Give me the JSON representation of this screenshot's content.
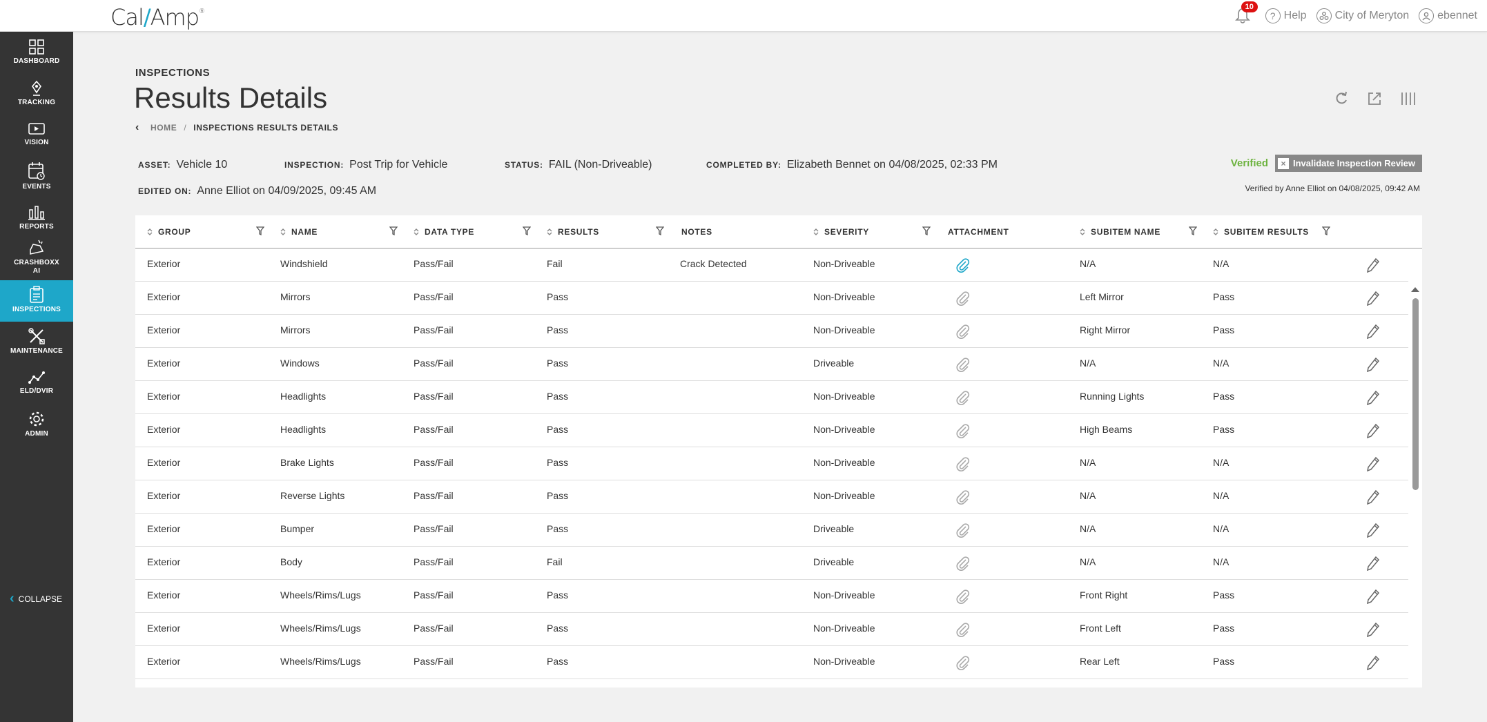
{
  "app": {
    "logo": {
      "left": "Cal",
      "slash": "/",
      "right": "Amp",
      "mark": "®"
    },
    "notifications_count": "10",
    "help_label": "Help",
    "org_label": "City of Meryton",
    "user_label": "ebennet"
  },
  "sidebar": {
    "items": [
      {
        "label": "DASHBOARD",
        "icon": "dashboard-icon"
      },
      {
        "label": "TRACKING",
        "icon": "location-pin-icon"
      },
      {
        "label": "VISION",
        "icon": "video-camera-icon"
      },
      {
        "label": "EVENTS",
        "icon": "calendar-clock-icon"
      },
      {
        "label": "REPORTS",
        "icon": "bar-chart-icon"
      },
      {
        "label": "CRASHBOXX AI",
        "icon": "crash-car-icon"
      },
      {
        "label": "INSPECTIONS",
        "icon": "clipboard-icon"
      },
      {
        "label": "MAINTENANCE",
        "icon": "wrench-screwdriver-icon"
      },
      {
        "label": "ELD/DVIR",
        "icon": "route-icon"
      },
      {
        "label": "ADMIN",
        "icon": "gear-icon"
      }
    ],
    "collapse_label": "COLLAPSE"
  },
  "page": {
    "section": "INSPECTIONS",
    "title": "Results Details",
    "breadcrumb_home": "HOME",
    "breadcrumb_sep": "/",
    "breadcrumb_current": "INSPECTIONS RESULTS DETAILS"
  },
  "meta": {
    "asset_label": "ASSET:",
    "asset": "Vehicle 10",
    "inspection_label": "INSPECTION:",
    "inspection": "Post Trip for Vehicle",
    "status_label": "STATUS:",
    "status": "FAIL (Non-Driveable)",
    "completed_label": "COMPLETED BY:",
    "completed": "Elizabeth Bennet on 04/08/2025, 02:33 PM",
    "edited_label": "EDITED ON:",
    "edited": "Anne Elliot on 04/09/2025, 09:45 AM",
    "verified_label": "Verified",
    "invalidate_label": "Invalidate Inspection Review",
    "verified_by": "Verified by Anne Elliot on 04/08/2025, 09:42 AM"
  },
  "colors": {
    "accent": "#1ea7c9",
    "verified": "#6db33f",
    "sidebar": "#343434"
  },
  "table": {
    "headers": [
      "GROUP",
      "NAME",
      "DATA TYPE",
      "RESULTS",
      "NOTES",
      "SEVERITY",
      "ATTACHMENT",
      "SUBITEM NAME",
      "SUBITEM RESULTS"
    ],
    "rows": [
      {
        "group": "Exterior",
        "name": "Windshield",
        "type": "Pass/Fail",
        "result": "Fail",
        "notes": "Crack Detected",
        "severity": "Non-Driveable",
        "attachment": true,
        "subname": "N/A",
        "subresult": "N/A"
      },
      {
        "group": "Exterior",
        "name": "Mirrors",
        "type": "Pass/Fail",
        "result": "Pass",
        "notes": "",
        "severity": "Non-Driveable",
        "attachment": false,
        "subname": "Left Mirror",
        "subresult": "Pass"
      },
      {
        "group": "Exterior",
        "name": "Mirrors",
        "type": "Pass/Fail",
        "result": "Pass",
        "notes": "",
        "severity": "Non-Driveable",
        "attachment": false,
        "subname": "Right Mirror",
        "subresult": "Pass"
      },
      {
        "group": "Exterior",
        "name": "Windows",
        "type": "Pass/Fail",
        "result": "Pass",
        "notes": "",
        "severity": "Driveable",
        "attachment": false,
        "subname": "N/A",
        "subresult": "N/A"
      },
      {
        "group": "Exterior",
        "name": "Headlights",
        "type": "Pass/Fail",
        "result": "Pass",
        "notes": "",
        "severity": "Non-Driveable",
        "attachment": false,
        "subname": "Running Lights",
        "subresult": "Pass"
      },
      {
        "group": "Exterior",
        "name": "Headlights",
        "type": "Pass/Fail",
        "result": "Pass",
        "notes": "",
        "severity": "Non-Driveable",
        "attachment": false,
        "subname": "High Beams",
        "subresult": "Pass"
      },
      {
        "group": "Exterior",
        "name": "Brake Lights",
        "type": "Pass/Fail",
        "result": "Pass",
        "notes": "",
        "severity": "Non-Driveable",
        "attachment": false,
        "subname": "N/A",
        "subresult": "N/A"
      },
      {
        "group": "Exterior",
        "name": "Reverse Lights",
        "type": "Pass/Fail",
        "result": "Pass",
        "notes": "",
        "severity": "Non-Driveable",
        "attachment": false,
        "subname": "N/A",
        "subresult": "N/A"
      },
      {
        "group": "Exterior",
        "name": "Bumper",
        "type": "Pass/Fail",
        "result": "Pass",
        "notes": "",
        "severity": "Driveable",
        "attachment": false,
        "subname": "N/A",
        "subresult": "N/A"
      },
      {
        "group": "Exterior",
        "name": "Body",
        "type": "Pass/Fail",
        "result": "Fail",
        "notes": "",
        "severity": "Driveable",
        "attachment": false,
        "subname": "N/A",
        "subresult": "N/A"
      },
      {
        "group": "Exterior",
        "name": "Wheels/Rims/Lugs",
        "type": "Pass/Fail",
        "result": "Pass",
        "notes": "",
        "severity": "Non-Driveable",
        "attachment": false,
        "subname": "Front Right",
        "subresult": "Pass"
      },
      {
        "group": "Exterior",
        "name": "Wheels/Rims/Lugs",
        "type": "Pass/Fail",
        "result": "Pass",
        "notes": "",
        "severity": "Non-Driveable",
        "attachment": false,
        "subname": "Front Left",
        "subresult": "Pass"
      },
      {
        "group": "Exterior",
        "name": "Wheels/Rims/Lugs",
        "type": "Pass/Fail",
        "result": "Pass",
        "notes": "",
        "severity": "Non-Driveable",
        "attachment": false,
        "subname": "Rear Left",
        "subresult": "Pass"
      }
    ]
  }
}
